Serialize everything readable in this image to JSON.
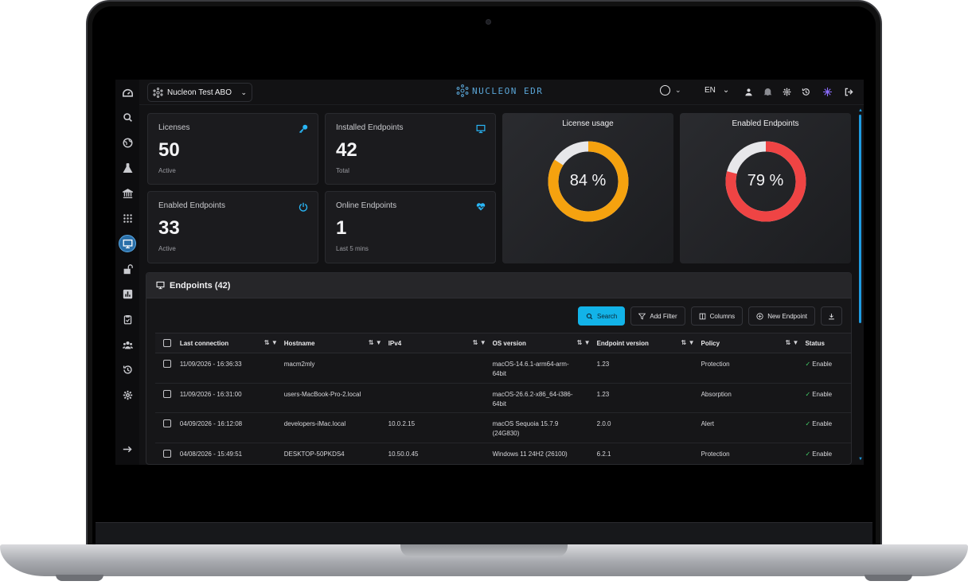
{
  "topbar": {
    "org_name": "Nucleon Test ABO",
    "brand": "NUCLEON EDR",
    "language": "EN"
  },
  "cards": [
    {
      "label": "Licenses",
      "value": "50",
      "sub": "Active",
      "icon": "key-icon"
    },
    {
      "label": "Installed Endpoints",
      "value": "42",
      "sub": "Total",
      "icon": "monitor-icon"
    },
    {
      "label": "Enabled Endpoints",
      "value": "33",
      "sub": "Active",
      "icon": "power-icon"
    },
    {
      "label": "Online Endpoints",
      "value": "1",
      "sub": "Last 5 mins",
      "icon": "heartbeat-icon"
    }
  ],
  "donuts": [
    {
      "title": "License usage",
      "pct_text": "84 %",
      "fraction": 0.84,
      "color": "#f5a20f"
    },
    {
      "title": "Enabled Endpoints",
      "pct_text": "79 %",
      "fraction": 0.79,
      "color": "#ef4444"
    }
  ],
  "panel": {
    "title": "Endpoints (42)",
    "buttons": {
      "search": "Search",
      "add_filter": "Add Filter",
      "columns": "Columns",
      "new_endpoint": "New Endpoint"
    },
    "columns": [
      "Last connection",
      "Hostname",
      "IPv4",
      "OS version",
      "Endpoint version",
      "Policy",
      "Status"
    ],
    "rows": [
      {
        "last_connection": "11/09/2026 - 16:36:33",
        "hostname": "macm2mly",
        "ipv4": "",
        "os": "macOS-14.6.1-arm64-arm-64bit",
        "version": "1.23",
        "policy": "Protection",
        "status": "Enable"
      },
      {
        "last_connection": "11/09/2026 - 16:31:00",
        "hostname": "users-MacBook-Pro-2.local",
        "ipv4": "",
        "os": "macOS-26.6.2-x86_64-i386-64bit",
        "version": "1.23",
        "policy": "Absorption",
        "status": "Enable"
      },
      {
        "last_connection": "04/09/2026 - 16:12:08",
        "hostname": "developers-iMac.local",
        "ipv4": "10.0.2.15",
        "os": "macOS Sequoia 15.7.9 (24G830)",
        "version": "2.0.0",
        "policy": "Alert",
        "status": "Enable"
      },
      {
        "last_connection": "04/08/2026 - 15:49:51",
        "hostname": "DESKTOP-50PKDS4",
        "ipv4": "10.50.0.45",
        "os": "Windows 11 24H2 (26100)",
        "version": "6.2.1",
        "policy": "Protection",
        "status": "Enable"
      }
    ]
  },
  "colors": {
    "accent": "#12b3e8",
    "ok": "#45d36b"
  }
}
